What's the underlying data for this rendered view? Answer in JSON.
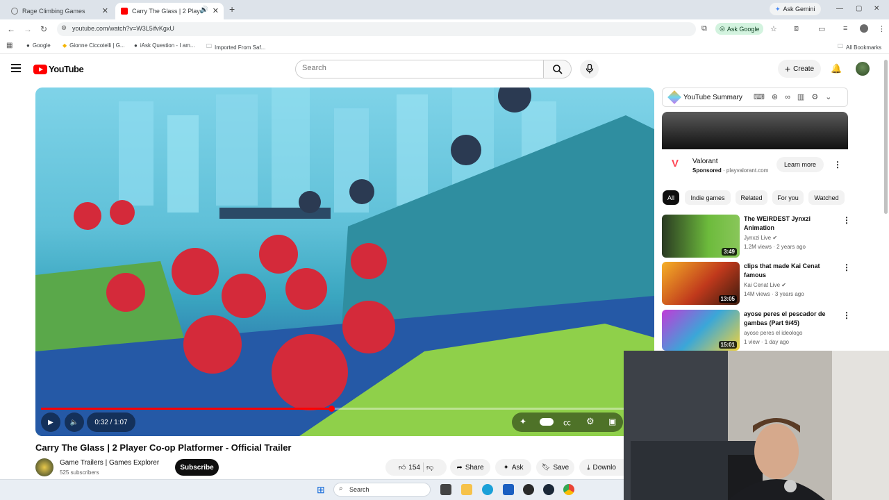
{
  "browser": {
    "tabs": [
      {
        "title": "Rage Climbing Games",
        "active": false
      },
      {
        "title": "Carry The Glass | 2 Player C",
        "active": true
      }
    ],
    "ask_gemini": "Ask Gemini",
    "url": "youtube.com/watch?v=W3L5ifvKgxU",
    "ask_google": "Ask Google",
    "bookmarks": [
      "Google",
      "Gionne Ciccotelli | G...",
      "iAsk Question - I am...",
      "Imported From Saf..."
    ],
    "all_bookmarks": "All Bookmarks"
  },
  "youtube": {
    "logo_text": "YouTube",
    "search_placeholder": "Search",
    "create_label": "Create"
  },
  "video": {
    "time": "0:32 / 1:07",
    "progress_fraction": 0.478,
    "title": "Carry The Glass | 2 Player Co-op Platformer - Official Trailer",
    "channel": "Game Trailers | Games Explorer",
    "subscribers": "525 subscribers",
    "subscribe_label": "Subscribe",
    "likes": "154",
    "share_label": "Share",
    "ask_label": "Ask",
    "save_label": "Save",
    "download_label": "Downlo"
  },
  "sidebar": {
    "summary_label": "YouTube Summary",
    "ad": {
      "title": "Valorant",
      "sponsored": "Sponsored",
      "domain": "· playvalorant.com",
      "learn_more": "Learn more"
    },
    "chips": [
      "All",
      "Indie games",
      "Related",
      "For you",
      "Watched"
    ],
    "recommendations": [
      {
        "title": "The WEIRDEST Jynxzi Animation",
        "channel": "Jynxzi Live",
        "meta": "1.2M views · 2 years ago",
        "duration": "3:49"
      },
      {
        "title": "clips that made Kai Cenat famous",
        "channel": "Kai Cenat Live",
        "meta": "14M views · 3 years ago",
        "duration": "13:05"
      },
      {
        "title": "ayose peres el pescador de gambas (Part 9/45)",
        "channel": "ayose peres el ideologo",
        "meta": "1 view · 1 day ago",
        "duration": "15:01"
      }
    ]
  },
  "taskbar": {
    "search_placeholder": "Search"
  }
}
